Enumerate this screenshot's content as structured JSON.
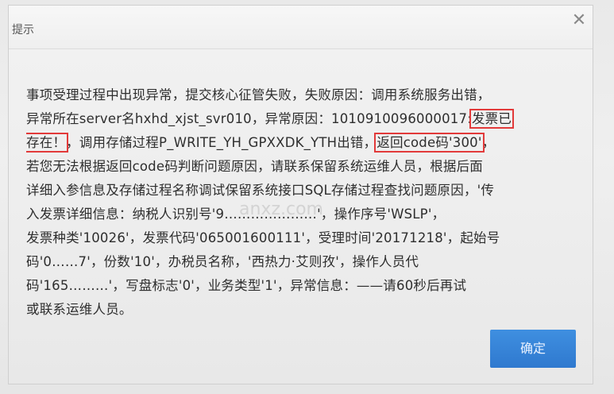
{
  "dialog": {
    "title": "提示",
    "close_icon": "close-icon",
    "ok_label": "确定"
  },
  "message": {
    "line1": "事项受理过程中出现异常，提交核心征管失败，失败原因：调用系统服务出错，",
    "line2_prefix": "异常所在server名hxhd_xjst_svr010，异常原因：1010910096000017:",
    "line2_highlight": "发票已",
    "line3_highlight": "存在！",
    "line3_middle": "，调用存储过程P_WRITE_YH_GPXXDK_YTH出错，",
    "line3_highlight2": "返回code码'300'",
    "line3_suffix": "，",
    "line4": "若您无法根据返回code码判断问题原因，请联系保留系统运维人员，根据后面",
    "line5": "详细入参信息及存储过程名称调试保留系统接口SQL存储过程查找问题原因，'传",
    "line6": "入发票详细信息：纳税人识别号'9…………………'，操作序号'WSLP'，",
    "line7": "发票种类'10026'，发票代码'065001600111'，受理时间'20171218'，起始号",
    "line8": "码'0……7'，份数'10'，办税员名称，'西热力·艾则孜'，操作人员代",
    "line9": "码'165………'，写盘标志'0'，业务类型'1'，异常信息：——请60秒后再试",
    "line10": "或联系运维人员。"
  },
  "watermark": "anxz.com",
  "colors": {
    "highlight_box": "#e23a3a",
    "button": "#2f79cf",
    "text": "#2e2e2e"
  }
}
